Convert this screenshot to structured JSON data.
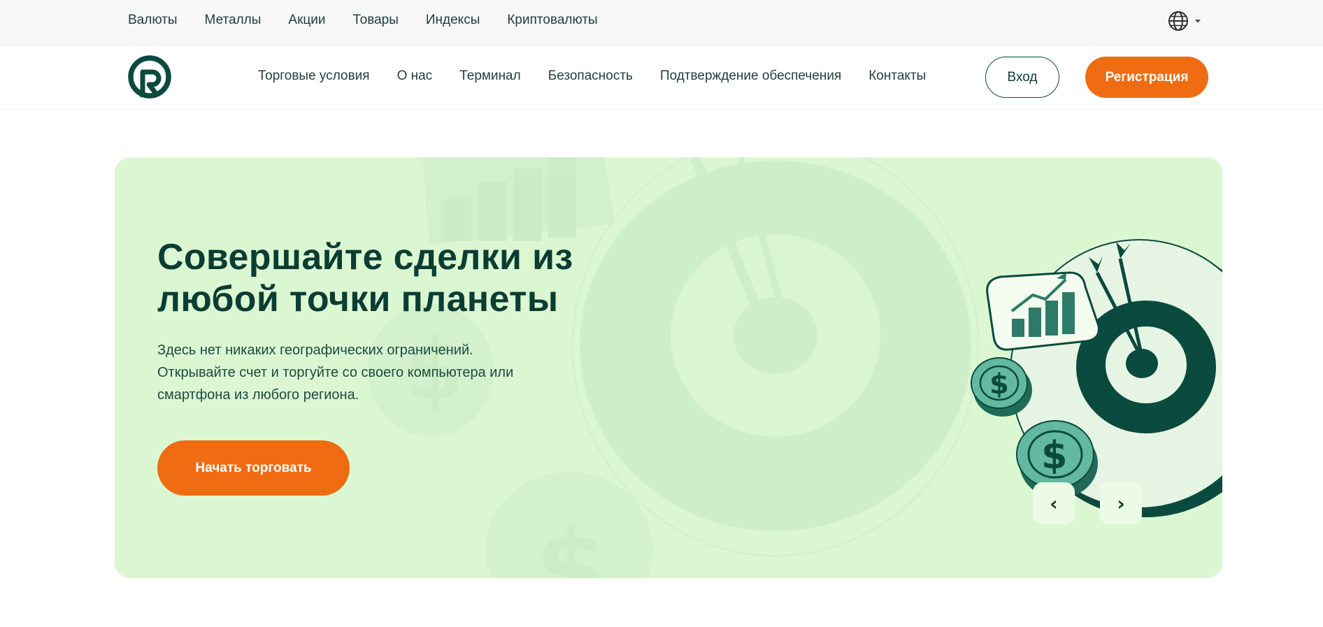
{
  "topbar": {
    "items": [
      {
        "label": "Валюты"
      },
      {
        "label": "Металлы"
      },
      {
        "label": "Акции"
      },
      {
        "label": "Товары"
      },
      {
        "label": "Индексы"
      },
      {
        "label": "Криптовалюты"
      }
    ],
    "language_icon": "globe-icon"
  },
  "header": {
    "logo_icon": "broker-logo",
    "nav": [
      {
        "label": "Торговые условия"
      },
      {
        "label": "О нас"
      },
      {
        "label": "Терминал"
      },
      {
        "label": "Безопасность"
      },
      {
        "label": "Подтверждение обеспечения"
      },
      {
        "label": "Контакты"
      }
    ],
    "login_label": "Вход",
    "register_label": "Регистрация"
  },
  "hero": {
    "title_line1": "Совершайте сделки из",
    "title_line2": "любой точки планеты",
    "text_line1": "Здесь нет никаких географических ограничений.",
    "text_line2": "Открывайте счет и торгуйте со своего компьютера или",
    "text_line3": "смартфона из любого региона.",
    "cta_label": "Начать торговать",
    "prev_symbol": "‹",
    "next_symbol": "›"
  },
  "colors": {
    "brand_green": "#0b4a3e",
    "accent_orange": "#ef6c12",
    "hero_background": "#dbf7d2"
  }
}
